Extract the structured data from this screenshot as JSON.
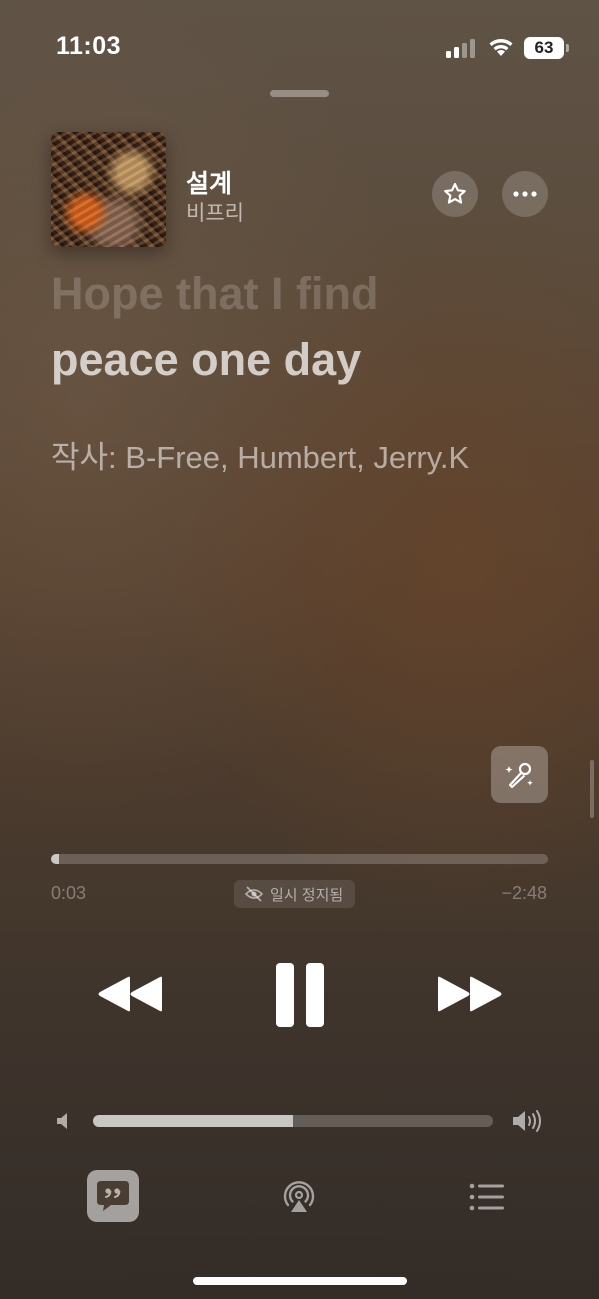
{
  "status_bar": {
    "time": "11:03",
    "battery": "63",
    "icons": [
      "cellular-signal-icon",
      "wifi-icon",
      "battery-icon"
    ]
  },
  "now_playing": {
    "title": "설계",
    "artist": "비프리"
  },
  "lyrics": {
    "previous_line": "Hope that I find",
    "current_line": "peace one day",
    "credits": "작사: B-Free, Humbert, Jerry.K"
  },
  "playback": {
    "elapsed": "0:03",
    "remaining": "−2:48",
    "progress_fraction": 0.017,
    "status_badge": "일시 정지됨"
  },
  "volume": {
    "level_fraction": 0.5
  },
  "colors": {
    "background_top": "#5f5346",
    "background_bottom": "#332c27",
    "accent_text": "#ffffff"
  },
  "icons": {
    "header": [
      "star-icon",
      "more-icon"
    ],
    "controls": [
      "rewind-icon",
      "pause-icon",
      "fast-forward-icon"
    ],
    "misc": [
      "sing-microphone-icon",
      "volume-low-icon",
      "volume-high-icon",
      "lyrics-quote-icon",
      "airplay-icon",
      "queue-list-icon",
      "lyrics-off-icon"
    ]
  }
}
